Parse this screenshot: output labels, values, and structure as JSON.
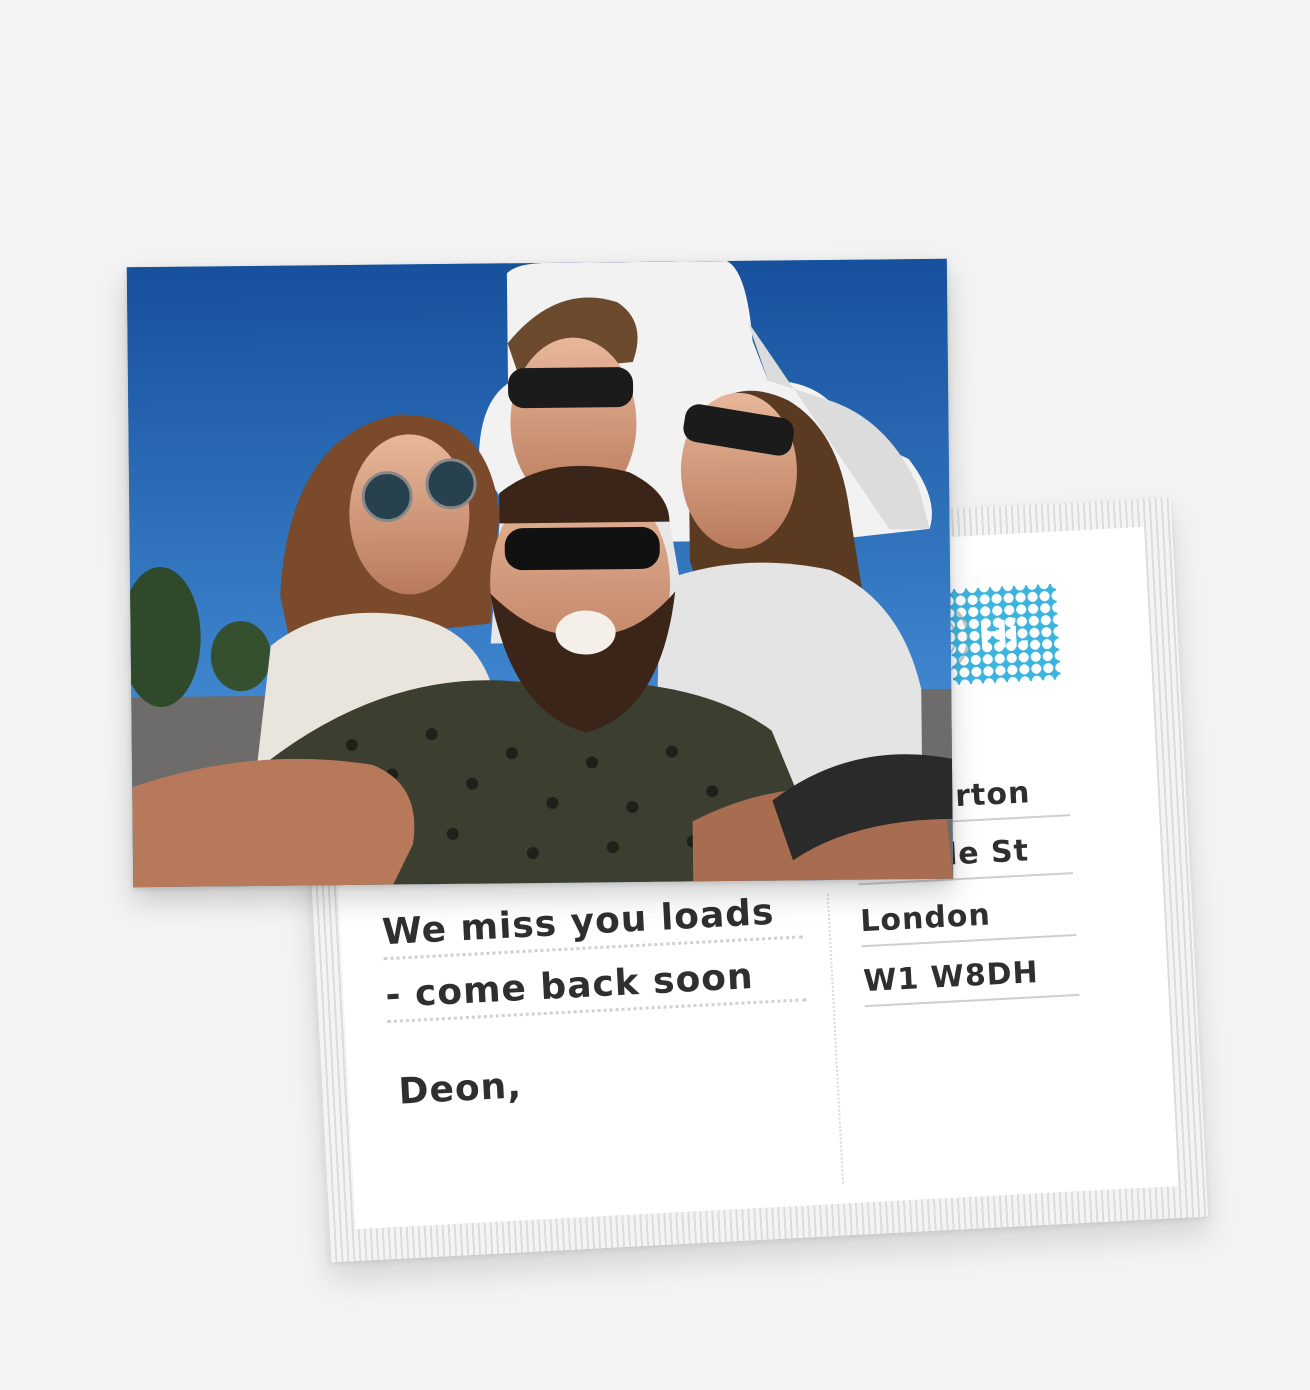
{
  "postcard": {
    "message_line_1": "We miss you loads",
    "message_line_2": "- come back soon",
    "signature": "Deon,",
    "address": {
      "line_1": "en Burton",
      "line_2": "rcastle St",
      "line_3": "London",
      "line_4": "W1 W8DH"
    },
    "stamp_text": "Hi."
  },
  "colors": {
    "background": "#f3f3f3",
    "stamp": "#3db4e0",
    "sky": "#1f64b5",
    "ink": "#2f2f2f"
  }
}
